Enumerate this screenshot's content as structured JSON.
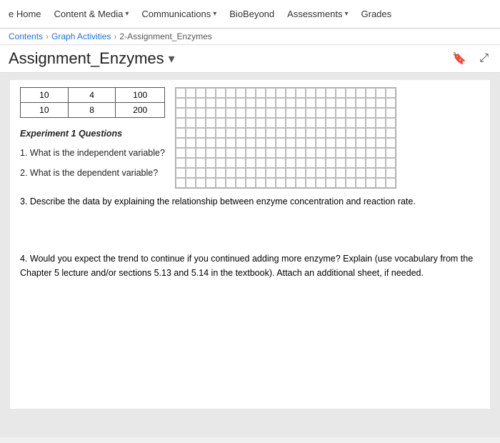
{
  "navbar": {
    "items": [
      {
        "label": "e Home",
        "has_arrow": false
      },
      {
        "label": "Content & Media",
        "has_arrow": true
      },
      {
        "label": "Communications",
        "has_arrow": true
      },
      {
        "label": "BioBeyond",
        "has_arrow": false
      },
      {
        "label": "Assessments",
        "has_arrow": true
      },
      {
        "label": "Grades",
        "has_arrow": false
      }
    ]
  },
  "breadcrumb": {
    "items": [
      {
        "label": "Contents",
        "link": true
      },
      {
        "label": "Graph Activities",
        "link": true
      },
      {
        "label": "2-Assignment_Enzymes",
        "link": false
      }
    ]
  },
  "page": {
    "title": "Assignment_Enzymes",
    "bookmark_icon": "🔖",
    "expand_icon": "⤢"
  },
  "table": {
    "rows": [
      [
        "10",
        "4",
        "100"
      ],
      [
        "10",
        "8",
        "200"
      ]
    ]
  },
  "questions": {
    "section_title": "Experiment 1 Questions",
    "q1_label": "1. What is the independent variable?",
    "q2_label": "2. What is the dependent variable?",
    "q3_label": "3. Describe the data by explaining the relationship between enzyme concentration and reaction rate.",
    "q4_label": "4. Would you expect the trend to continue if you continued adding more enzyme? Explain (use vocabulary from the Chapter 5 lecture and/or sections 5.13 and 5.14 in the textbook). Attach an additional sheet, if needed."
  },
  "grid": {
    "cols": 22,
    "rows": 10
  }
}
